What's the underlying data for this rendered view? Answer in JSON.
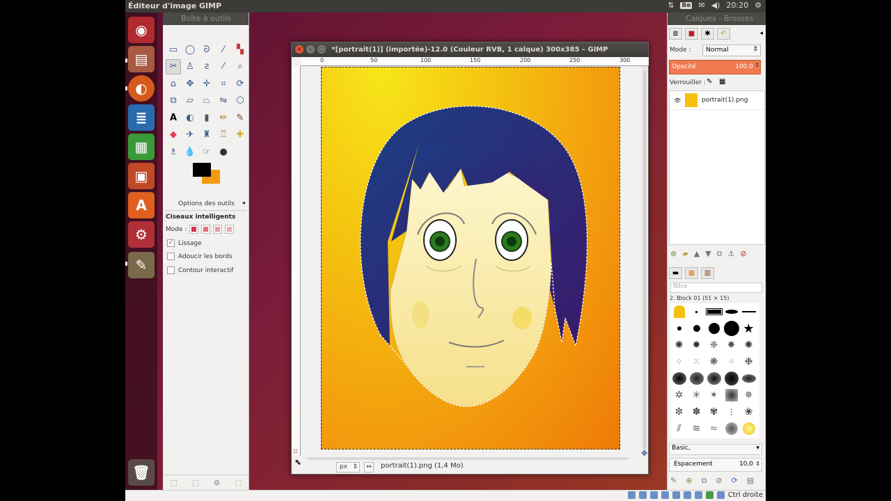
{
  "topbar": {
    "title": "Éditeur d'image GIMP",
    "keyboard": "Be",
    "clock": "20:20"
  },
  "launcher": {
    "apps": [
      "dash-icon",
      "files-icon",
      "firefox-icon",
      "writer-icon",
      "calc-icon",
      "impress-icon",
      "software-center-icon",
      "system-settings-icon",
      "gimp-icon",
      "trash-icon"
    ]
  },
  "toolbox": {
    "title": "Boîte à outils",
    "tools": [
      "rect-select",
      "ellipse-select",
      "free-select",
      "fuzzy-select",
      "select-by-color",
      "scissors-select",
      "foreground-select",
      "paths",
      "color-picker",
      "zoom",
      "measure",
      "move",
      "align",
      "crop",
      "rotate",
      "scale",
      "shear",
      "perspective",
      "flip",
      "cage",
      "text",
      "bucket-fill",
      "blend",
      "pencil",
      "paintbrush",
      "eraser",
      "airbrush",
      "ink",
      "clone",
      "heal",
      "perspective-clone",
      "blur",
      "smudge",
      "dodge-burn"
    ],
    "options_tab": "Options des outils",
    "options_title": "Ciseaux intelligents",
    "mode_label": "Mode :",
    "checkboxes": [
      {
        "label": "Lissage",
        "checked": true
      },
      {
        "label": "Adoucir les bords",
        "checked": false
      },
      {
        "label": "Contour interactif",
        "checked": false
      }
    ]
  },
  "image_window": {
    "title": "*[portrait(1)] (importée)-12.0 (Couleur RVB, 1 calque) 300x385 – GIMP",
    "ruler_labels": [
      "0",
      "50",
      "100",
      "150",
      "200",
      "250",
      "300"
    ],
    "unit": "px",
    "zoom": "↔",
    "status": "portrait(1).png (1,4 Mo)"
  },
  "dock": {
    "title": "Calques - Brosses",
    "mode_label": "Mode :",
    "mode_value": "Normal",
    "opacity_label": "Opacité",
    "opacity_value": "100,0",
    "lock_label": "Verrouiller :",
    "layer_name": "portrait(1).png",
    "filter_placeholder": "filtre",
    "brush_name": "2. Block 01 (51 × 15)",
    "brush_tag": "Basic,",
    "spacing_label": "Espacement",
    "spacing_value": "10,0"
  },
  "bottombar": {
    "right_text": "Ctrl droite"
  },
  "colors": {
    "foreground": "#000000",
    "background": "#f29a10",
    "hair": "#1f3d8a",
    "face": "#fbf2b8"
  }
}
